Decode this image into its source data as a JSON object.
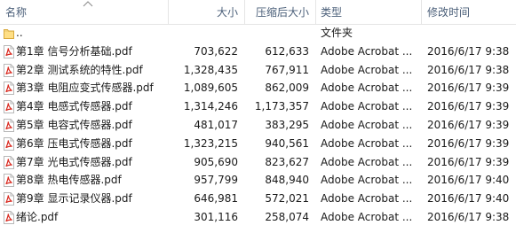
{
  "header": {
    "name": "名称",
    "size": "大小",
    "compressed": "压缩后大小",
    "type": "类型",
    "modified": "修改时间"
  },
  "rows": [
    {
      "icon": "folder-icon",
      "name": "..",
      "size": "",
      "compressed": "",
      "type": "文件夹",
      "modified": ""
    },
    {
      "icon": "pdf-file-icon",
      "name": "第1章 信号分析基础.pdf",
      "size": "703,622",
      "compressed": "612,633",
      "type": "Adobe Acrobat ...",
      "modified": "2016/6/17 9:38"
    },
    {
      "icon": "pdf-file-icon",
      "name": "第2章 测试系统的特性.pdf",
      "size": "1,328,435",
      "compressed": "767,911",
      "type": "Adobe Acrobat ...",
      "modified": "2016/6/17 9:38"
    },
    {
      "icon": "pdf-file-icon",
      "name": "第3章 电阻应变式传感器.pdf",
      "size": "1,089,605",
      "compressed": "862,009",
      "type": "Adobe Acrobat ...",
      "modified": "2016/6/17 9:39"
    },
    {
      "icon": "pdf-file-icon",
      "name": "第4章 电感式传感器.pdf",
      "size": "1,314,246",
      "compressed": "1,173,357",
      "type": "Adobe Acrobat ...",
      "modified": "2016/6/17 9:39"
    },
    {
      "icon": "pdf-file-icon",
      "name": "第5章 电容式传感器.pdf",
      "size": "481,017",
      "compressed": "383,295",
      "type": "Adobe Acrobat ...",
      "modified": "2016/6/17 9:39"
    },
    {
      "icon": "pdf-file-icon",
      "name": "第6章 压电式传感器.pdf",
      "size": "1,323,215",
      "compressed": "940,561",
      "type": "Adobe Acrobat ...",
      "modified": "2016/6/17 9:39"
    },
    {
      "icon": "pdf-file-icon",
      "name": "第7章 光电式传感器.pdf",
      "size": "905,690",
      "compressed": "823,627",
      "type": "Adobe Acrobat ...",
      "modified": "2016/6/17 9:39"
    },
    {
      "icon": "pdf-file-icon",
      "name": "第8章 热电传感器.pdf",
      "size": "957,799",
      "compressed": "848,940",
      "type": "Adobe Acrobat ...",
      "modified": "2016/6/17 9:40"
    },
    {
      "icon": "pdf-file-icon",
      "name": "第9章 显示记录仪器.pdf",
      "size": "646,981",
      "compressed": "572,021",
      "type": "Adobe Acrobat ...",
      "modified": "2016/6/17 9:40"
    },
    {
      "icon": "pdf-file-icon",
      "name": "绪论.pdf",
      "size": "301,116",
      "compressed": "258,074",
      "type": "Adobe Acrobat ...",
      "modified": "2016/6/17 9:38"
    }
  ],
  "colors": {
    "header_text": "#4c607a",
    "folder": "#e8c15a",
    "pdf_red": "#d9281e",
    "hover_row": "#e5f3ff"
  }
}
